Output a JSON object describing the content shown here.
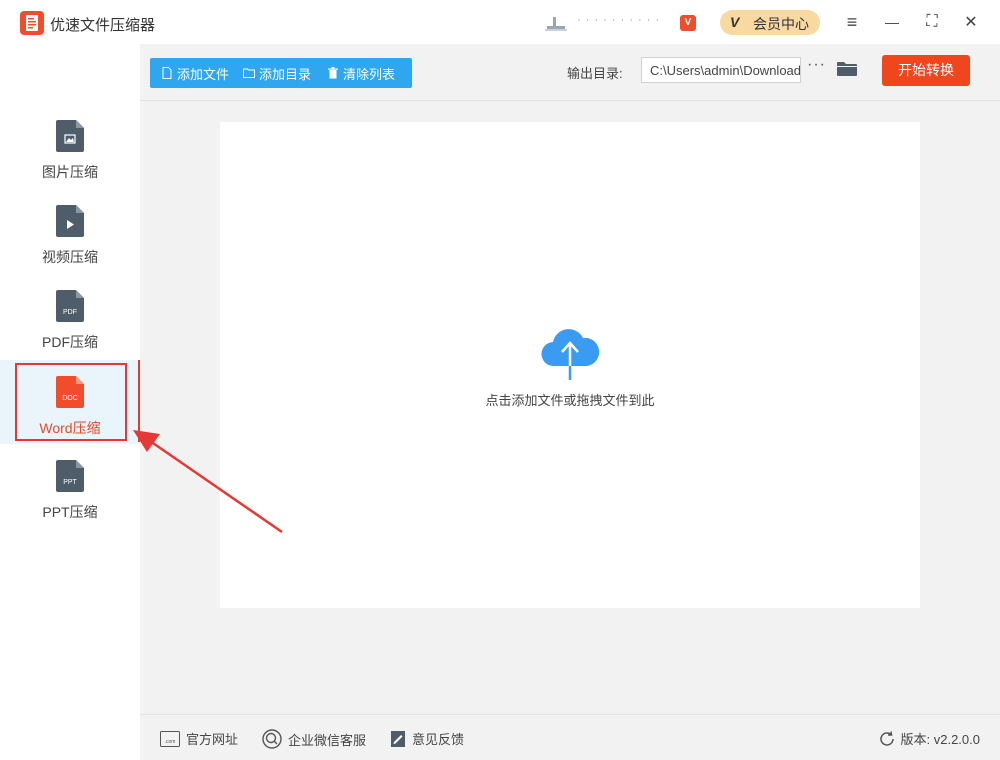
{
  "app": {
    "title": "优速文件压缩器"
  },
  "user": {
    "name": "· · · · · · · · · ·",
    "badge": "V"
  },
  "vip": {
    "icon": "V",
    "label": "会员中心"
  },
  "window": {
    "menu": "≡",
    "minimize": "—",
    "maximize": "⛶",
    "close": "✕"
  },
  "sidebar": {
    "items": [
      {
        "label": "图片压缩",
        "icon_text": ""
      },
      {
        "label": "视频压缩",
        "icon_text": ""
      },
      {
        "label": "PDF压缩",
        "icon_text": "PDF"
      },
      {
        "label": "Word压缩",
        "icon_text": "DOC"
      },
      {
        "label": "PPT压缩",
        "icon_text": "PPT"
      }
    ],
    "active_index": 3
  },
  "toolbar": {
    "add_file": "添加文件",
    "add_dir": "添加目录",
    "clear_list": "清除列表",
    "output_label": "输出目录:",
    "output_path": "C:\\Users\\admin\\Downloads",
    "more": "···",
    "start": "开始转换"
  },
  "dropzone": {
    "text": "点击添加文件或拖拽文件到此"
  },
  "footer": {
    "website": "官方网址",
    "wechat": "企业微信客服",
    "feedback": "意见反馈",
    "version": "版本: v2.2.0.0"
  },
  "colors": {
    "accent": "#2ea7f0",
    "start": "#f0461e",
    "active": "#e34a2a",
    "annotation": "#e53935"
  }
}
